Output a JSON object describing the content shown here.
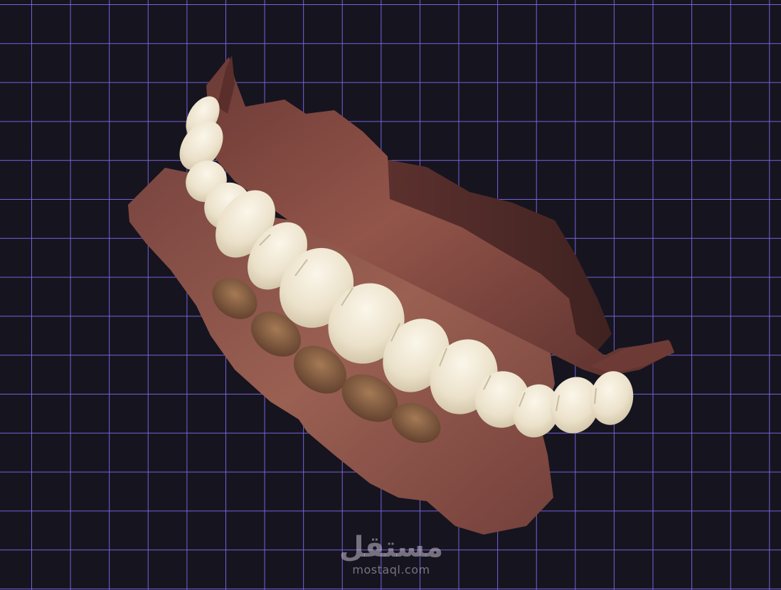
{
  "viewport": {
    "background_color": "#16141f",
    "grid_color": "#7c66e6"
  },
  "model": {
    "gum_color": "#8c4f44",
    "tooth_color": "#efe6d2"
  },
  "watermark": {
    "logo_text": "مستقل",
    "url_text": "mostaql.com"
  }
}
